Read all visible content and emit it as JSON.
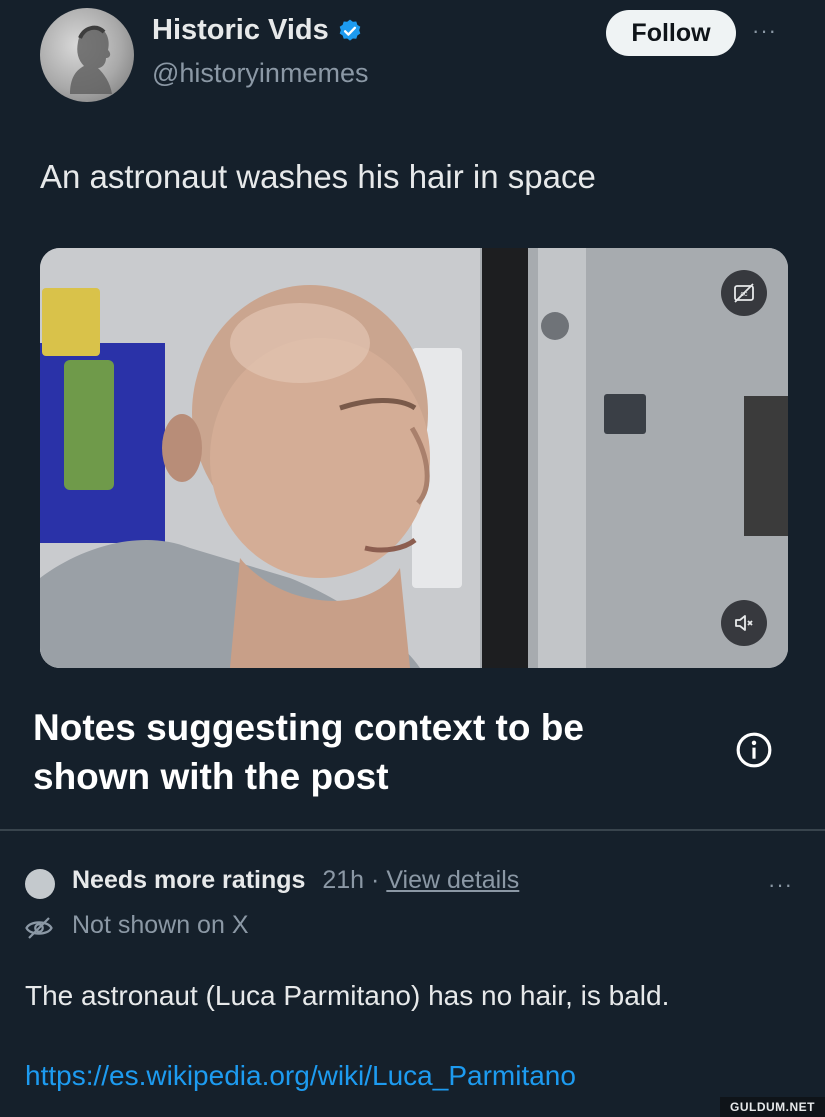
{
  "post": {
    "author_name": "Historic Vids",
    "author_handle": "@historyinmemes",
    "follow_label": "Follow",
    "more_label": "···",
    "text": "An astronaut washes his hair in space",
    "verified_icon": "verified-badge-icon",
    "accent_color": "#1d9bf0"
  },
  "media": {
    "type": "video",
    "caption_icon": "closed-captions-off-icon",
    "mute_icon": "speaker-muted-icon"
  },
  "community_notes": {
    "heading": "Notes suggesting context to be shown with the post",
    "info_icon": "info-icon"
  },
  "note": {
    "status": "Needs more ratings",
    "time": "21h",
    "separator": "·",
    "view_details_label": "View details",
    "more_label": "···",
    "visibility": "Not shown on X",
    "visibility_icon": "eye-off-icon",
    "body": "The astronaut (Luca Parmitano) has no hair, is bald.",
    "link": "https://es.wikipedia.org/wiki/Luca_Parmitano"
  },
  "watermark": "GULDUM.NET"
}
